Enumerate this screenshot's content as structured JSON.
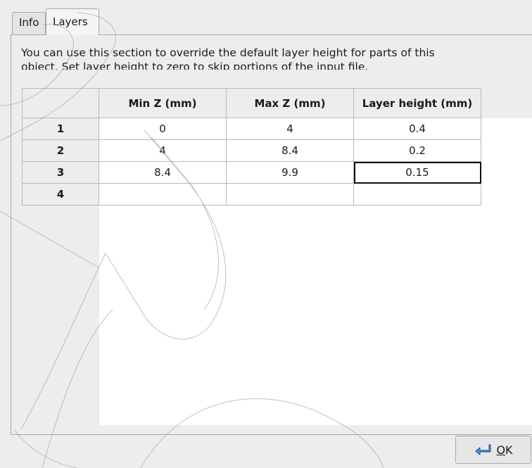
{
  "tabs": [
    {
      "label": "Info"
    },
    {
      "label": "Layers"
    }
  ],
  "description": {
    "line1": "You can use this section to override the default layer height for parts of this",
    "line2": "object. Set layer height to zero to skip portions of the input file."
  },
  "table": {
    "columns": [
      "",
      "Min Z (mm)",
      "Max Z (mm)",
      "Layer height (mm)"
    ],
    "rows": [
      {
        "index": "1",
        "min_z": "0",
        "max_z": "4",
        "layer_height": "0.4"
      },
      {
        "index": "2",
        "min_z": "4",
        "max_z": "8.4",
        "layer_height": "0.2"
      },
      {
        "index": "3",
        "min_z": "8.4",
        "max_z": "9.9",
        "layer_height": "0.15"
      },
      {
        "index": "4",
        "min_z": "",
        "max_z": "",
        "layer_height": ""
      }
    ]
  },
  "footer": {
    "ok_mnemonic": "O",
    "ok_rest": "K",
    "ok_icon": "return-arrow-icon"
  }
}
